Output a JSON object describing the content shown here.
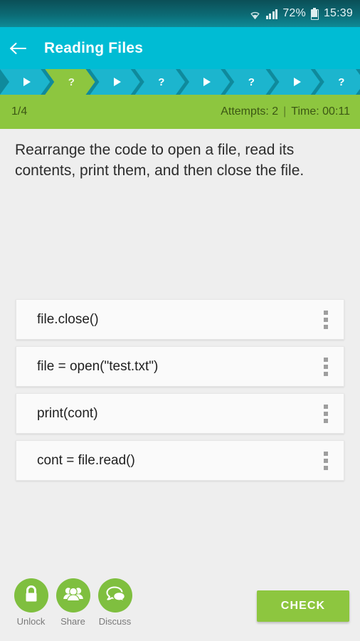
{
  "status_bar": {
    "wifi_icon": "wifi-icon",
    "signal_icon": "signal-bars-icon",
    "battery_percent": "72%",
    "battery_icon": "battery-icon",
    "time": "15:39"
  },
  "toolbar": {
    "back_icon": "back-arrow-icon",
    "title": "Reading Files",
    "background_color": "#00bcd4"
  },
  "progress": {
    "bar_background": "#0f8a9c",
    "chevron_color": "#1cb5ce",
    "current_color": "#8dc63f",
    "current_index": 1,
    "steps": [
      {
        "type": "play",
        "glyph": "▶",
        "state": "done"
      },
      {
        "type": "question",
        "glyph": "?",
        "state": "current"
      },
      {
        "type": "play",
        "glyph": "▶",
        "state": "upcoming"
      },
      {
        "type": "question",
        "glyph": "?",
        "state": "upcoming"
      },
      {
        "type": "play",
        "glyph": "▶",
        "state": "upcoming"
      },
      {
        "type": "question",
        "glyph": "?",
        "state": "upcoming"
      },
      {
        "type": "play",
        "glyph": "▶",
        "state": "upcoming"
      },
      {
        "type": "question",
        "glyph": "?",
        "state": "upcoming"
      }
    ]
  },
  "stats": {
    "position": "1/4",
    "attempts_label": "Attempts: 2",
    "separator": "|",
    "time_label": "Time: 00:11",
    "background_color": "#8dc63f"
  },
  "question": {
    "text": "Rearrange the code to open a file, read its contents, print them, and then close the file."
  },
  "cards": [
    {
      "code": "file.close()",
      "handle_icon": "drag-handle-icon"
    },
    {
      "code": "file = open(\"test.txt\")",
      "handle_icon": "drag-handle-icon"
    },
    {
      "code": "print(cont)",
      "handle_icon": "drag-handle-icon"
    },
    {
      "code": "cont = file.read()",
      "handle_icon": "drag-handle-icon"
    }
  ],
  "bottom_actions": [
    {
      "label": "Unlock",
      "icon": "lock-icon"
    },
    {
      "label": "Share",
      "icon": "people-group-icon"
    },
    {
      "label": "Discuss",
      "icon": "speech-bubbles-icon"
    }
  ],
  "check_button": {
    "label": "CHECK",
    "color": "#8dc63f"
  }
}
